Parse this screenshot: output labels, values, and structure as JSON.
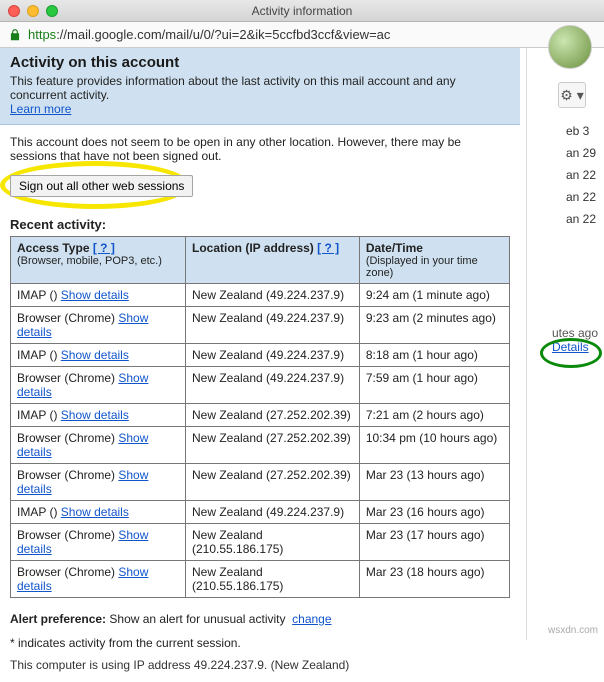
{
  "window": {
    "title": "Activity information"
  },
  "url": {
    "scheme": "https",
    "rest": "://mail.google.com/mail/u/0/?ui=2&ik=5ccfbd3ccf&view=ac"
  },
  "banner": {
    "heading": "Activity on this account",
    "desc": "This feature provides information about the last activity on this mail account and any concurrent activity.",
    "learn": "Learn more"
  },
  "note": "This account does not seem to be open in any other location. However, there may be sessions that have not been signed out.",
  "signout": "Sign out all other web sessions",
  "recent": "Recent activity:",
  "headers": {
    "access": "Access Type",
    "access_help": "[ ? ]",
    "access_sub": "(Browser, mobile, POP3, etc.)",
    "location": "Location (IP address)",
    "location_help": "[ ? ]",
    "datetime": "Date/Time",
    "datetime_sub": "(Displayed in your time zone)"
  },
  "rows": [
    {
      "a1": "IMAP ()",
      "a2": "Show details",
      "loc": "New Zealand (49.224.237.9)",
      "dt": "9:24 am (1 minute ago)"
    },
    {
      "a1": "Browser (Chrome)",
      "a2": "Show details",
      "loc": "New Zealand (49.224.237.9)",
      "dt": "9:23 am (2 minutes ago)"
    },
    {
      "a1": "IMAP ()",
      "a2": "Show details",
      "loc": "New Zealand (49.224.237.9)",
      "dt": "8:18 am (1 hour ago)"
    },
    {
      "a1": "Browser (Chrome)",
      "a2": "Show details",
      "loc": "New Zealand (49.224.237.9)",
      "dt": "7:59 am (1 hour ago)"
    },
    {
      "a1": "IMAP ()",
      "a2": "Show details",
      "loc": "New Zealand (27.252.202.39)",
      "dt": "7:21 am (2 hours ago)"
    },
    {
      "a1": "Browser (Chrome)",
      "a2": "Show details",
      "loc": "New Zealand (27.252.202.39)",
      "dt": "10:34 pm (10 hours ago)"
    },
    {
      "a1": "Browser (Chrome)",
      "a2": "Show details",
      "loc": "New Zealand (27.252.202.39)",
      "dt": "Mar 23 (13 hours ago)"
    },
    {
      "a1": "IMAP ()",
      "a2": "Show details",
      "loc": "New Zealand (49.224.237.9)",
      "dt": "Mar 23 (16 hours ago)"
    },
    {
      "a1": "Browser (Chrome)",
      "a2": "Show details",
      "loc": "New Zealand (210.55.186.175)",
      "dt": "Mar 23 (17 hours ago)"
    },
    {
      "a1": "Browser (Chrome)",
      "a2": "Show details",
      "loc": "New Zealand (210.55.186.175)",
      "dt": "Mar 23 (18 hours ago)"
    }
  ],
  "alert": {
    "label": "Alert preference:",
    "text": "Show an alert for unusual activity",
    "change": "change"
  },
  "star_note": "* indicates activity from the current session.",
  "ip_note": "This computer is using IP address 49.224.237.9. (New Zealand)",
  "side": {
    "dates": [
      "eb 3",
      "an 29",
      "an 22",
      "an 22",
      "an 22"
    ],
    "utes": "utes ago",
    "details": "Details"
  },
  "gear_glyph": "⚙ ▾",
  "watermark": "wsxdn.com"
}
